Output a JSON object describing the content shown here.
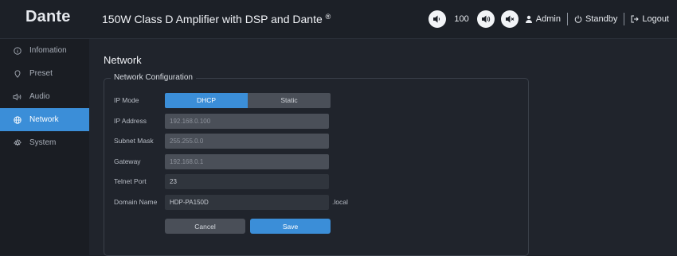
{
  "app": {
    "logo": "Dante",
    "title": "150W Class D Amplifier with DSP and Dante",
    "title_mark": "®"
  },
  "header": {
    "volume_value": "100",
    "admin_label": "Admin",
    "standby_label": "Standby",
    "logout_label": "Logout"
  },
  "sidebar": {
    "items": [
      {
        "label": "Infomation",
        "icon": "info-icon"
      },
      {
        "label": "Preset",
        "icon": "preset-icon"
      },
      {
        "label": "Audio",
        "icon": "audio-icon"
      },
      {
        "label": "Network",
        "icon": "globe-icon",
        "active": true
      },
      {
        "label": "System",
        "icon": "gear-icon"
      }
    ]
  },
  "network": {
    "page_title": "Network",
    "section_title": "Network Configuration",
    "ip_mode": {
      "label": "IP Mode",
      "options": [
        "DHCP",
        "Static"
      ],
      "selected": "DHCP"
    },
    "ip_address": {
      "label": "IP Address",
      "value": "192.168.0.100"
    },
    "subnet_mask": {
      "label": "Subnet Mask",
      "value": "255.255.0.0"
    },
    "gateway": {
      "label": "Gateway",
      "value": "192.168.0.1"
    },
    "telnet_port": {
      "label": "Telnet Port",
      "value": "23"
    },
    "domain_name": {
      "label": "Domain Name",
      "value": "HDP-PA150D",
      "suffix": ".local"
    },
    "cancel_label": "Cancel",
    "save_label": "Save"
  },
  "colors": {
    "accent": "#3b8ed8",
    "background": "#20242c"
  }
}
